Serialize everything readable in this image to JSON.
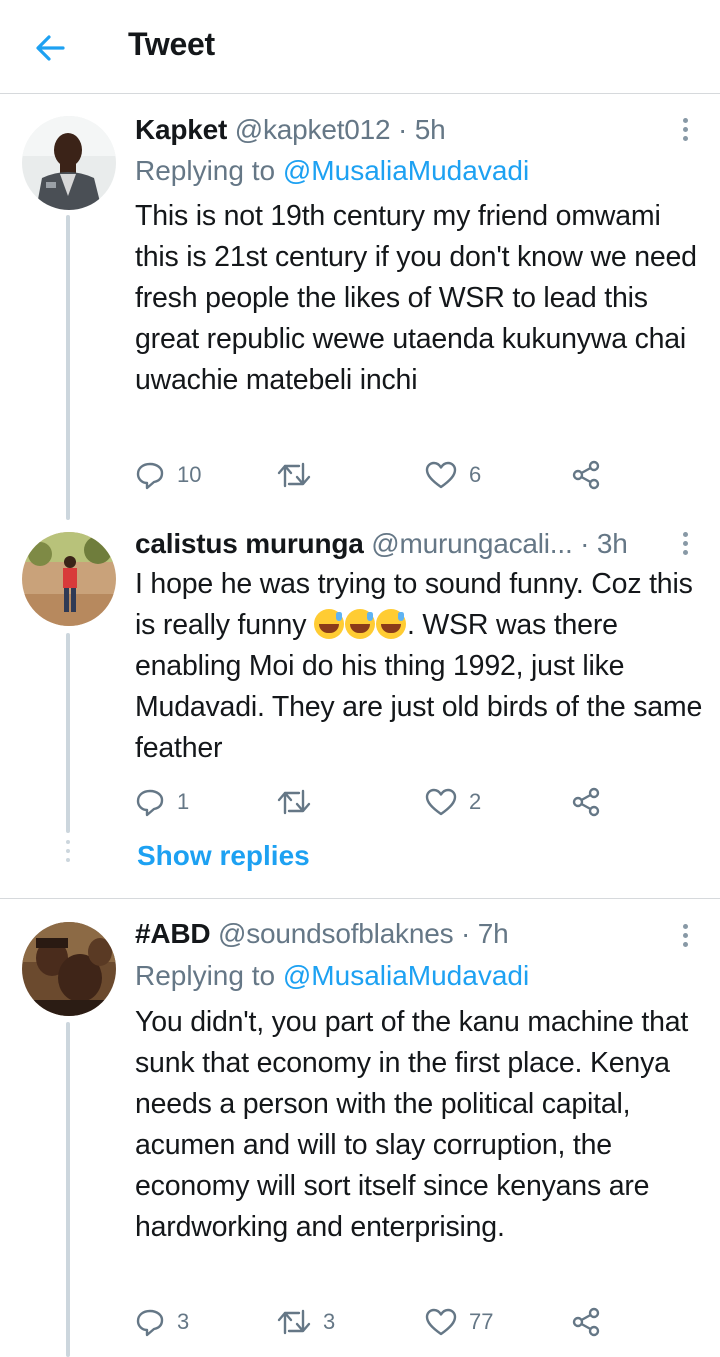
{
  "header": {
    "title": "Tweet"
  },
  "tweets": [
    {
      "name": "Kapket",
      "handle": "@kapket012",
      "time": "5h",
      "replying_prefix": "Replying to",
      "replying_to": "@MusaliaMudavadi",
      "body": "This is not 19th century my friend omwami this is 21st century if you don't know we need fresh people the likes of WSR to lead this great republic wewe utaenda kukunywa chai uwachie matebeli inchi",
      "replies": "10",
      "retweets": "",
      "likes": "6"
    },
    {
      "name": "calistus murunga",
      "handle": "@murungacali...",
      "time": "3h",
      "body_before_emoji": "I hope he was trying to sound funny. Coz this is really funny ",
      "body_after_emoji": ". WSR was there enabling Moi do his thing 1992, just like Mudavadi. They are just old birds of the same feather",
      "emoji_count": 3,
      "replies": "1",
      "retweets": "",
      "likes": "2"
    },
    {
      "name": "#ABD",
      "handle": "@soundsofblaknes",
      "time": "7h",
      "replying_prefix": "Replying to",
      "replying_to": "@MusaliaMudavadi",
      "body": "You didn't, you part of the kanu machine that sunk that economy in the first place. Kenya needs a person with the political capital, acumen and will to slay corruption, the economy will sort itself since kenyans are hardworking and enterprising.",
      "replies": "3",
      "retweets": "3",
      "likes": "77"
    }
  ],
  "show_replies": "Show replies",
  "colors": {
    "accent": "#1da1f2",
    "secondary_text": "#657786",
    "divider": "#d6d9dc"
  },
  "icons": [
    "back-arrow-icon",
    "more-icon",
    "reply-icon",
    "retweet-icon",
    "like-icon",
    "share-icon"
  ]
}
